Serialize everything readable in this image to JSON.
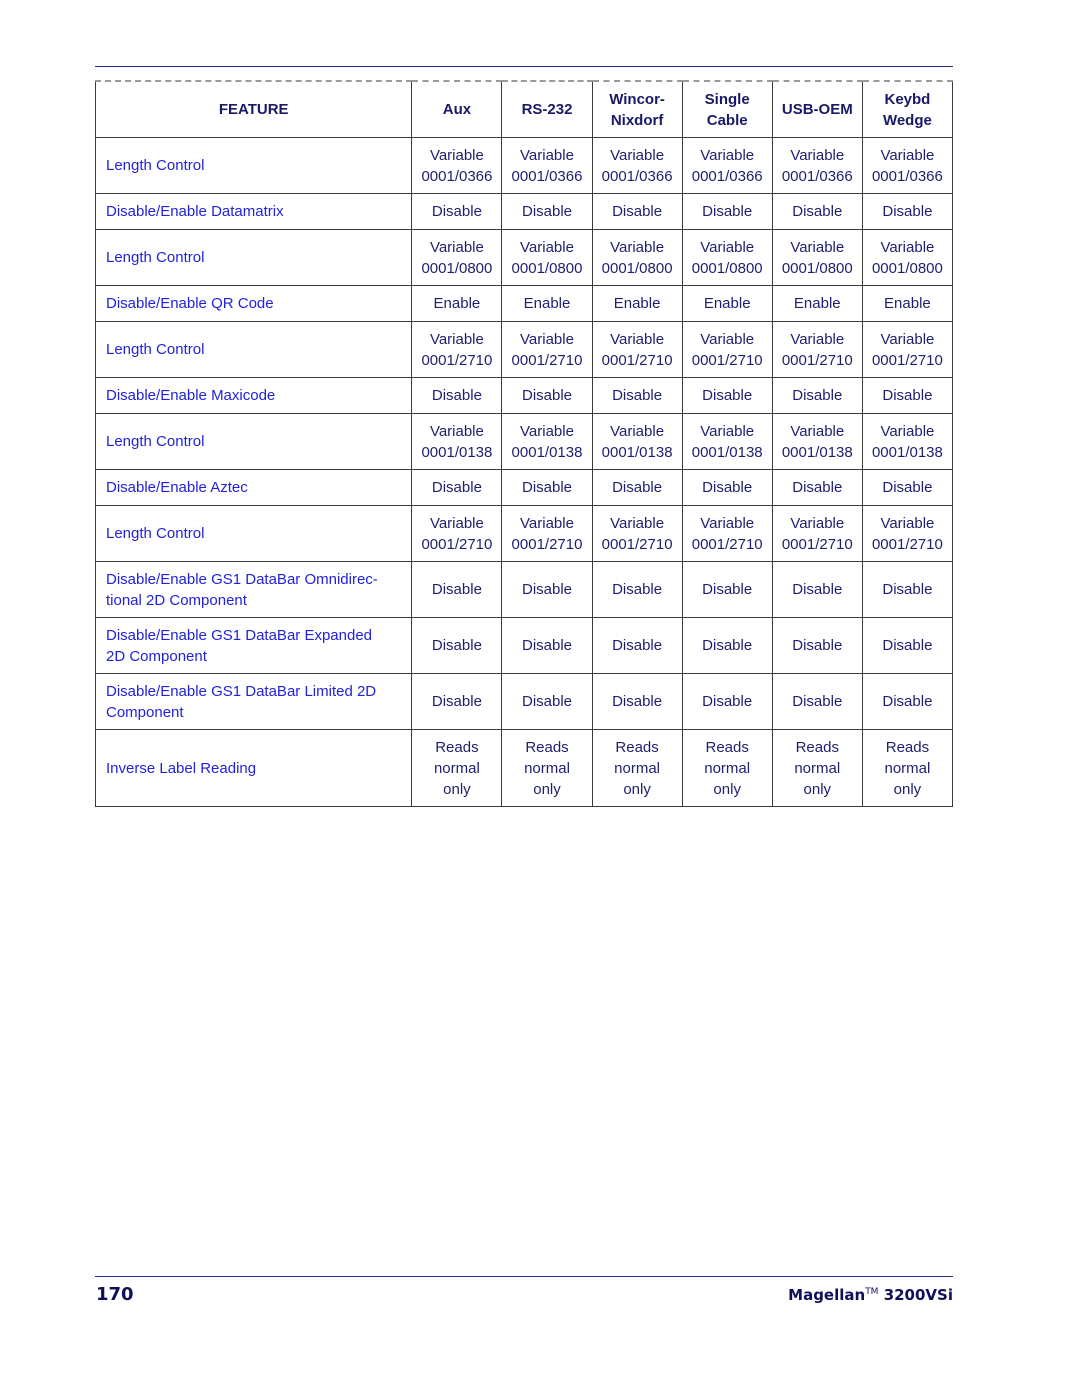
{
  "table": {
    "headers": [
      {
        "lines": [
          "FEATURE"
        ]
      },
      {
        "lines": [
          "Aux"
        ]
      },
      {
        "lines": [
          "RS-232"
        ]
      },
      {
        "lines": [
          "Wincor-",
          "Nixdorf"
        ]
      },
      {
        "lines": [
          "Single",
          "Cable"
        ]
      },
      {
        "lines": [
          "USB-OEM"
        ]
      },
      {
        "lines": [
          "Keybd",
          "Wedge"
        ]
      }
    ],
    "rows": [
      {
        "feature": [
          "Length Control"
        ],
        "values": [
          [
            "Variable",
            "0001/0366"
          ],
          [
            "Variable",
            "0001/0366"
          ],
          [
            "Variable",
            "0001/0366"
          ],
          [
            "Variable",
            "0001/0366"
          ],
          [
            "Variable",
            "0001/0366"
          ],
          [
            "Variable",
            "0001/0366"
          ]
        ],
        "size": "tall"
      },
      {
        "feature": [
          "Disable/Enable Datamatrix"
        ],
        "values": [
          [
            "Disable"
          ],
          [
            "Disable"
          ],
          [
            "Disable"
          ],
          [
            "Disable"
          ],
          [
            "Disable"
          ],
          [
            "Disable"
          ]
        ],
        "size": "short"
      },
      {
        "feature": [
          "Length Control"
        ],
        "values": [
          [
            "Variable",
            "0001/0800"
          ],
          [
            "Variable",
            "0001/0800"
          ],
          [
            "Variable",
            "0001/0800"
          ],
          [
            "Variable",
            "0001/0800"
          ],
          [
            "Variable",
            "0001/0800"
          ],
          [
            "Variable",
            "0001/0800"
          ]
        ],
        "size": "tall"
      },
      {
        "feature": [
          "Disable/Enable QR Code"
        ],
        "values": [
          [
            "Enable"
          ],
          [
            "Enable"
          ],
          [
            "Enable"
          ],
          [
            "Enable"
          ],
          [
            "Enable"
          ],
          [
            "Enable"
          ]
        ],
        "size": "short"
      },
      {
        "feature": [
          "Length Control"
        ],
        "values": [
          [
            "Variable",
            "0001/2710"
          ],
          [
            "Variable",
            "0001/2710"
          ],
          [
            "Variable",
            "0001/2710"
          ],
          [
            "Variable",
            "0001/2710"
          ],
          [
            "Variable",
            "0001/2710"
          ],
          [
            "Variable",
            "0001/2710"
          ]
        ],
        "size": "tall"
      },
      {
        "feature": [
          "Disable/Enable Maxicode"
        ],
        "values": [
          [
            "Disable"
          ],
          [
            "Disable"
          ],
          [
            "Disable"
          ],
          [
            "Disable"
          ],
          [
            "Disable"
          ],
          [
            "Disable"
          ]
        ],
        "size": "short"
      },
      {
        "feature": [
          "Length Control"
        ],
        "values": [
          [
            "Variable",
            "0001/0138"
          ],
          [
            "Variable",
            "0001/0138"
          ],
          [
            "Variable",
            "0001/0138"
          ],
          [
            "Variable",
            "0001/0138"
          ],
          [
            "Variable",
            "0001/0138"
          ],
          [
            "Variable",
            "0001/0138"
          ]
        ],
        "size": "tall"
      },
      {
        "feature": [
          "Disable/Enable Aztec"
        ],
        "values": [
          [
            "Disable"
          ],
          [
            "Disable"
          ],
          [
            "Disable"
          ],
          [
            "Disable"
          ],
          [
            "Disable"
          ],
          [
            "Disable"
          ]
        ],
        "size": "short"
      },
      {
        "feature": [
          "Length Control"
        ],
        "values": [
          [
            "Variable",
            "0001/2710"
          ],
          [
            "Variable",
            "0001/2710"
          ],
          [
            "Variable",
            "0001/2710"
          ],
          [
            "Variable",
            "0001/2710"
          ],
          [
            "Variable",
            "0001/2710"
          ],
          [
            "Variable",
            "0001/2710"
          ]
        ],
        "size": "tall"
      },
      {
        "feature": [
          "Disable/Enable GS1 DataBar Omnidirec-",
          "tional 2D Component"
        ],
        "values": [
          [
            "Disable"
          ],
          [
            "Disable"
          ],
          [
            "Disable"
          ],
          [
            "Disable"
          ],
          [
            "Disable"
          ],
          [
            "Disable"
          ]
        ],
        "size": "tall"
      },
      {
        "feature": [
          "Disable/Enable GS1 DataBar Expanded",
          "2D Component"
        ],
        "values": [
          [
            "Disable"
          ],
          [
            "Disable"
          ],
          [
            "Disable"
          ],
          [
            "Disable"
          ],
          [
            "Disable"
          ],
          [
            "Disable"
          ]
        ],
        "size": "tall"
      },
      {
        "feature": [
          "Disable/Enable GS1 DataBar Limited 2D",
          "Component"
        ],
        "values": [
          [
            "Disable"
          ],
          [
            "Disable"
          ],
          [
            "Disable"
          ],
          [
            "Disable"
          ],
          [
            "Disable"
          ],
          [
            "Disable"
          ]
        ],
        "size": "tall"
      },
      {
        "feature": [
          "Inverse Label Reading"
        ],
        "values": [
          [
            "Reads",
            "normal",
            "only"
          ],
          [
            "Reads",
            "normal",
            "only"
          ],
          [
            "Reads",
            "normal",
            "only"
          ],
          [
            "Reads",
            "normal",
            "only"
          ],
          [
            "Reads",
            "normal",
            "only"
          ],
          [
            "Reads",
            "normal",
            "only"
          ]
        ],
        "size": "tall3"
      }
    ]
  },
  "footer": {
    "page_number": "170",
    "product_name": "Magellan",
    "trademark": "TM",
    "product_model": "3200VSi"
  }
}
